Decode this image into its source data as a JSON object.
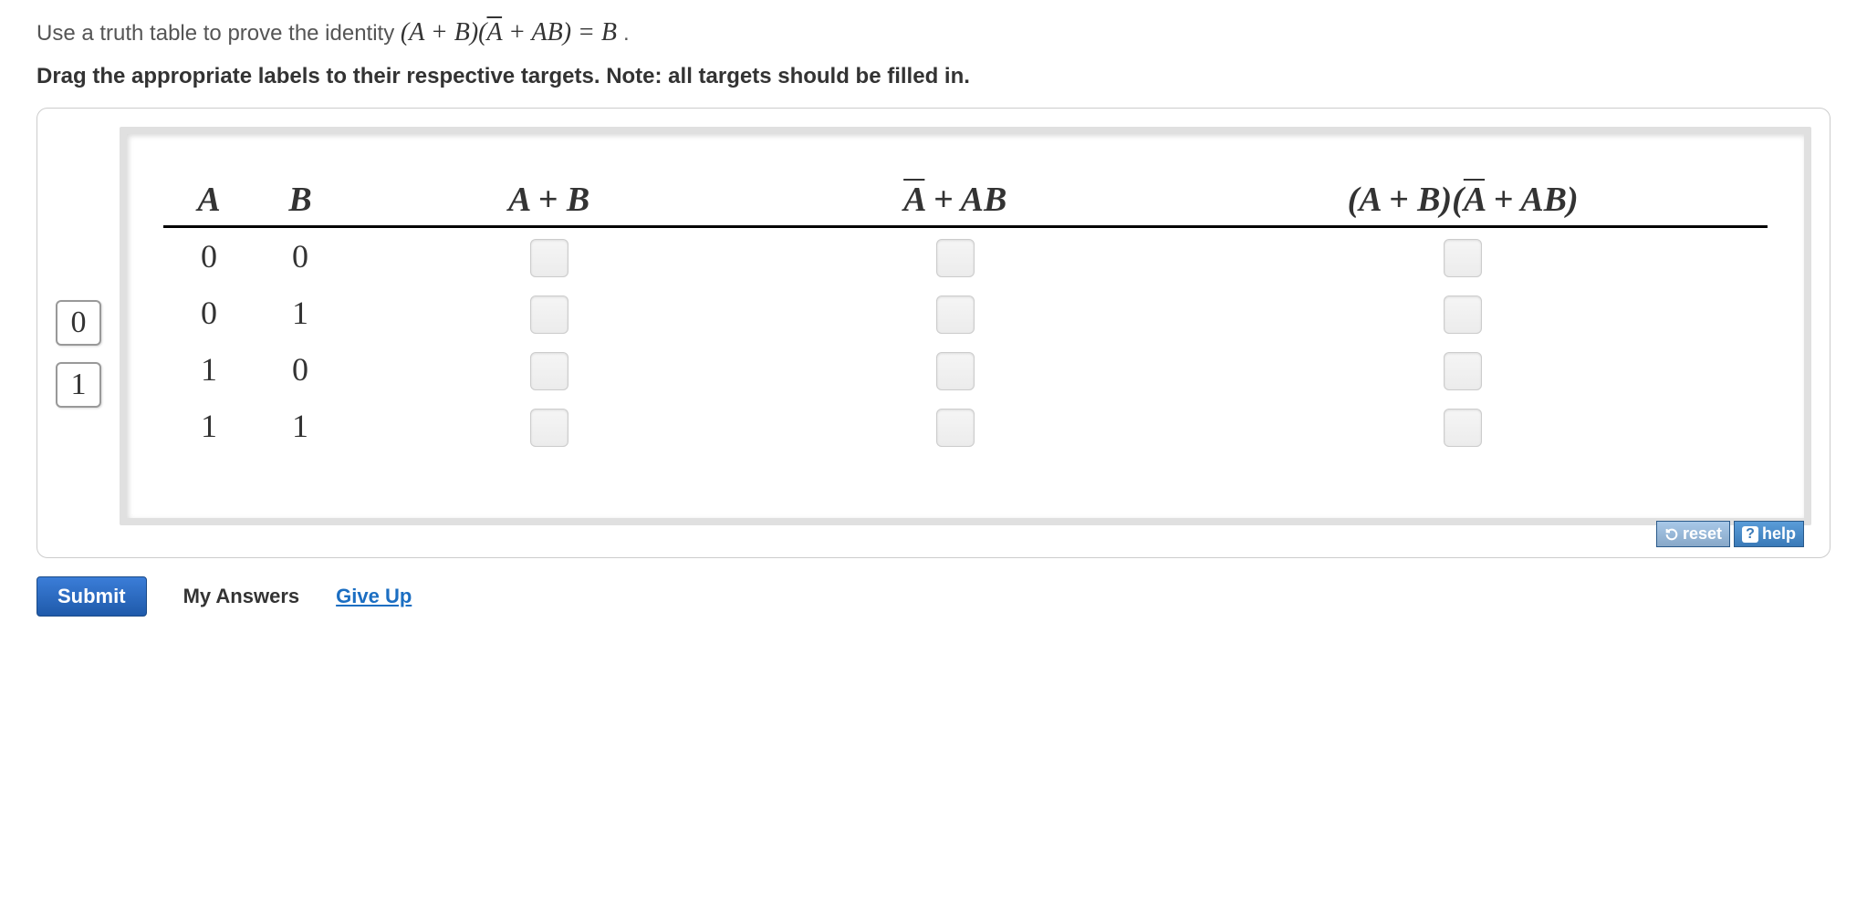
{
  "question": {
    "prefix": "Use a truth table to prove the identity ",
    "expr_lhs_1": "(A + B)(",
    "expr_abar": "A",
    "expr_lhs_2": " + AB) = B",
    "suffix": "."
  },
  "instruction": "Drag the appropriate labels to their respective targets. Note: all targets should be filled in.",
  "drag_labels": [
    "0",
    "1"
  ],
  "headers": {
    "a": "A",
    "b": "B",
    "c": "A + B",
    "d_pre": "A",
    "d_post": " + AB",
    "e_pre": "(A + B)(",
    "e_bar": "A",
    "e_post": " + AB)"
  },
  "rows": [
    {
      "a": "0",
      "b": "0"
    },
    {
      "a": "0",
      "b": "1"
    },
    {
      "a": "1",
      "b": "0"
    },
    {
      "a": "1",
      "b": "1"
    }
  ],
  "buttons": {
    "reset": "reset",
    "help": "help",
    "submit": "Submit",
    "my_answers": "My Answers",
    "give_up": "Give Up"
  }
}
